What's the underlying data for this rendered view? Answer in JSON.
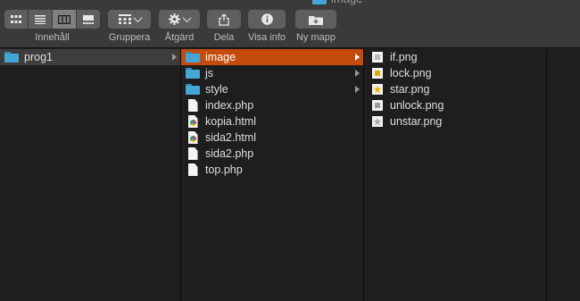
{
  "window": {
    "title": "image"
  },
  "toolbar": {
    "view_label": "Innehåll",
    "group_label": "Gruppera",
    "action_label": "Åtgärd",
    "share_label": "Dela",
    "info_label": "Visa info",
    "newfolder_label": "Ny mapp"
  },
  "columns": {
    "col1": [
      "prog1"
    ],
    "col2": [
      "image",
      "js",
      "style",
      "index.php",
      "kopia.html",
      "sida2.html",
      "sida2.php",
      "top.php"
    ],
    "col3": [
      "if.png",
      "lock.png",
      "star.png",
      "unlock.png",
      "unstar.png"
    ]
  },
  "colors": {
    "selection": "#c44b0b",
    "folder": "#44a6d4",
    "background": "#1e1e1e"
  }
}
